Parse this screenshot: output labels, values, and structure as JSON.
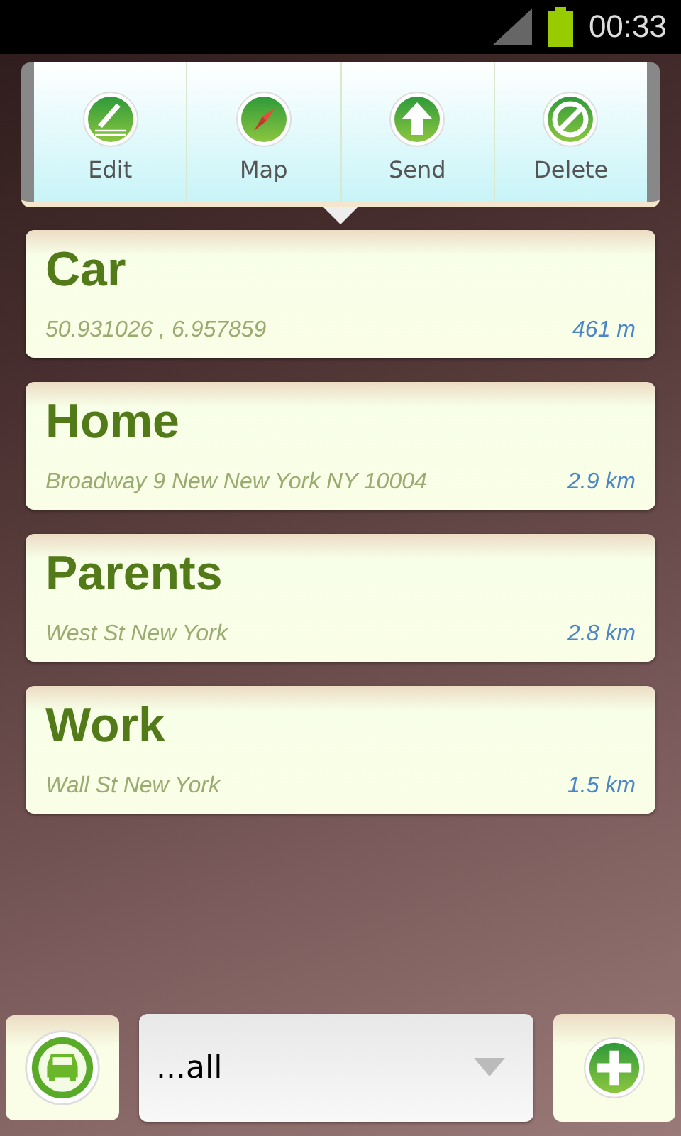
{
  "status_bar": {
    "time": "00:33"
  },
  "actions": [
    {
      "label": "Edit",
      "kind": "edit"
    },
    {
      "label": "Map",
      "kind": "map"
    },
    {
      "label": "Send",
      "kind": "send"
    },
    {
      "label": "Delete",
      "kind": "delete"
    }
  ],
  "places": [
    {
      "name": "Car",
      "detail": "50.931026 , 6.957859",
      "distance": "461 m"
    },
    {
      "name": "Home",
      "detail": "Broadway 9 New New York NY 10004",
      "distance": "2.9 km"
    },
    {
      "name": "Parents",
      "detail": "West St New York",
      "distance": "2.8 km"
    },
    {
      "name": "Work",
      "detail": "Wall St New York",
      "distance": "1.5 km"
    }
  ],
  "filter": {
    "value": "...all"
  }
}
